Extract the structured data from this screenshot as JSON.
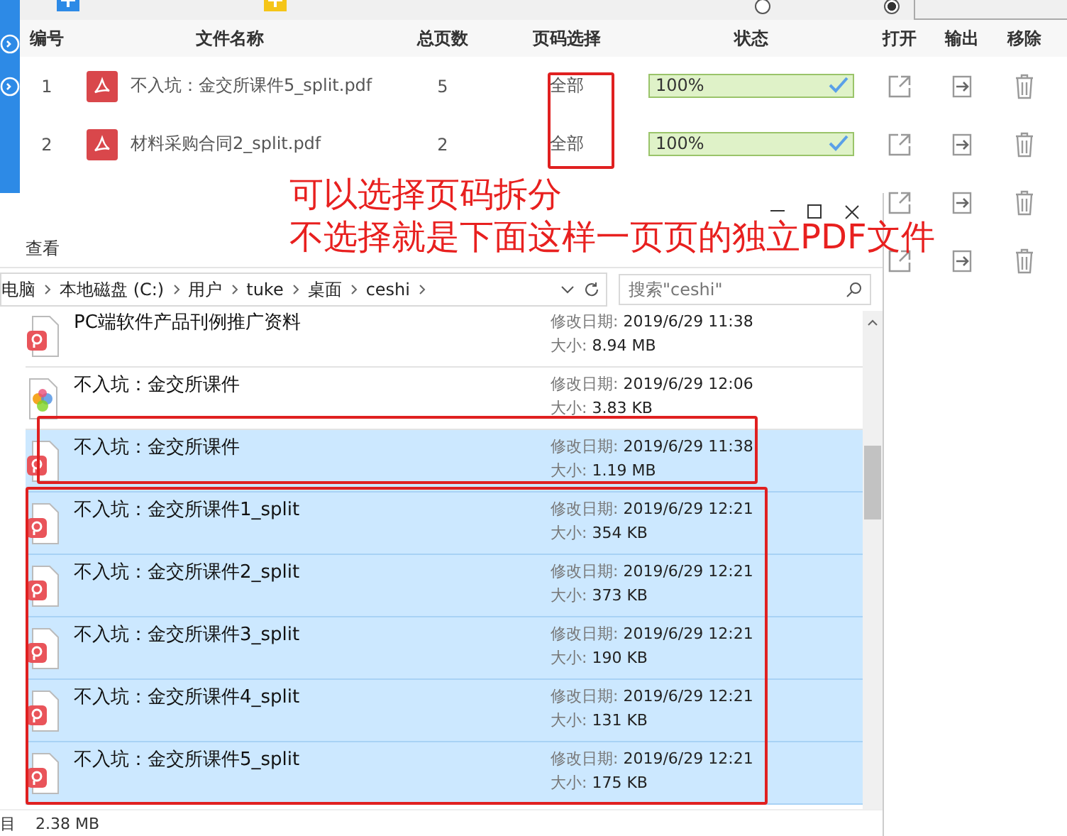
{
  "app": {
    "toolbar": {
      "options": [
        {
          "selected": false
        },
        {
          "selected": true
        }
      ]
    },
    "columns": [
      "编号",
      "文件名称",
      "总页数",
      "页码选择",
      "状态",
      "打开",
      "输出",
      "移除"
    ],
    "rows": [
      {
        "number": "1",
        "name": "不入坑：金交所课件5_split.pdf",
        "pages": "5",
        "page_selection": "全部",
        "status": "100%",
        "level": 1
      },
      {
        "number": "2",
        "name": "材料采购合同2_split.pdf",
        "pages": "2",
        "page_selection": "全部",
        "status": "100%",
        "level": 1
      }
    ]
  },
  "annotation": {
    "lines": [
      "可以选择页码拆分",
      "不选择就是下面这样一页页的独立PDF文件"
    ]
  },
  "explorer": {
    "ribbon_tab": "查看",
    "breadcrumb": [
      "电脑",
      "本地磁盘 (C:)",
      "用户",
      "tuke",
      "桌面",
      "ceshi"
    ],
    "search": {
      "placeholder": "搜索\"ceshi\""
    },
    "files": [
      {
        "kind": "pdf",
        "name": "PC端软件产品刊例推广资料",
        "date_label": "修改日期:",
        "date": "2019/6/29 11:38",
        "size_label": "大小:",
        "size": "8.94 MB",
        "selected": false
      },
      {
        "kind": "image",
        "name": "不入坑：金交所课件",
        "date_label": "修改日期:",
        "date": "2019/6/29 12:06",
        "size_label": "大小:",
        "size": "3.83 KB",
        "selected": false
      },
      {
        "kind": "pdf",
        "name": "不入坑：金交所课件",
        "date_label": "修改日期:",
        "date": "2019/6/29 11:38",
        "size_label": "大小:",
        "size": "1.19 MB",
        "selected": true
      },
      {
        "kind": "pdf",
        "name": "不入坑：金交所课件1_split",
        "date_label": "修改日期:",
        "date": "2019/6/29 12:21",
        "size_label": "大小:",
        "size": "354 KB",
        "selected": true
      },
      {
        "kind": "pdf",
        "name": "不入坑：金交所课件2_split",
        "date_label": "修改日期:",
        "date": "2019/6/29 12:21",
        "size_label": "大小:",
        "size": "373 KB",
        "selected": true
      },
      {
        "kind": "pdf",
        "name": "不入坑：金交所课件3_split",
        "date_label": "修改日期:",
        "date": "2019/6/29 12:21",
        "size_label": "大小:",
        "size": "190 KB",
        "selected": true
      },
      {
        "kind": "pdf",
        "name": "不入坑：金交所课件4_split",
        "date_label": "修改日期:",
        "date": "2019/6/29 12:21",
        "size_label": "大小:",
        "size": "131 KB",
        "selected": true
      },
      {
        "kind": "pdf",
        "name": "不入坑：金交所课件5_split",
        "date_label": "修改日期:",
        "date": "2019/6/29 12:21",
        "size_label": "大小:",
        "size": "175 KB",
        "selected": true
      }
    ],
    "status_bar": {
      "items_label": "目",
      "total_size": "2.38 MB"
    }
  }
}
